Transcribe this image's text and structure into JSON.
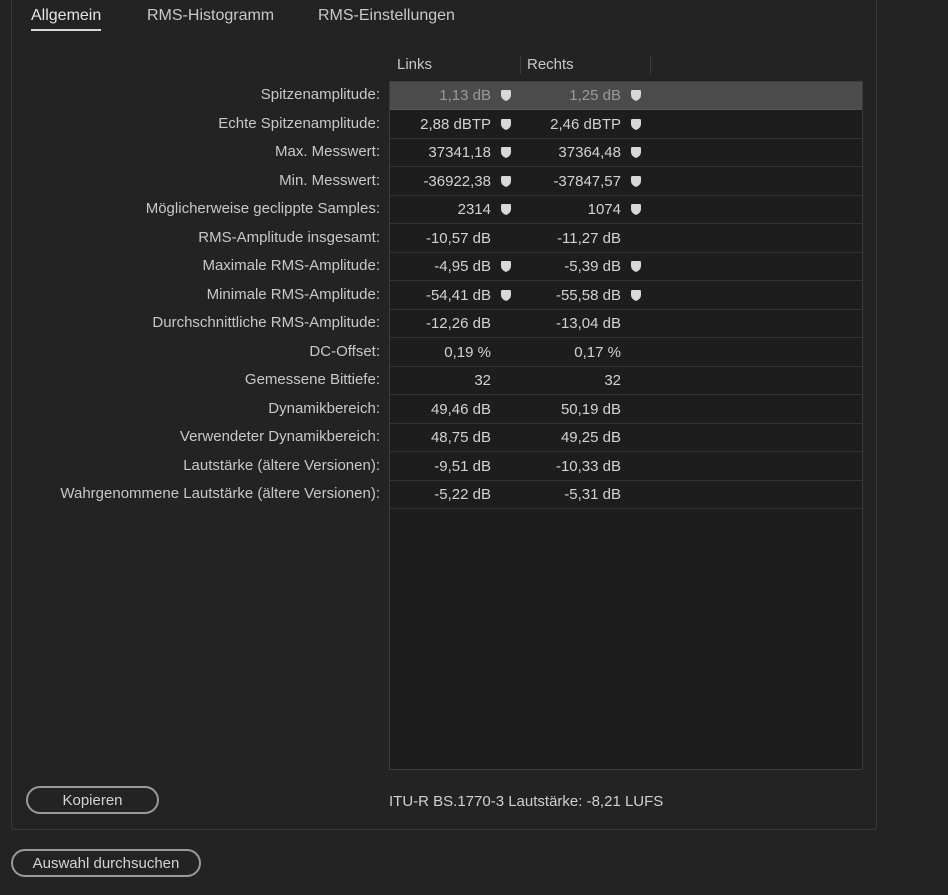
{
  "tabs": [
    {
      "label": "Allgemein",
      "active": true
    },
    {
      "label": "RMS-Histogramm",
      "active": false
    },
    {
      "label": "RMS-Einstellungen",
      "active": false
    }
  ],
  "columns": {
    "left": "Links",
    "right": "Rechts"
  },
  "rows": [
    {
      "label": "Spitzenamplitude:",
      "left": "1,13 dB",
      "right": "1,25 dB",
      "marker": true,
      "selected": true
    },
    {
      "label": "Echte Spitzenamplitude:",
      "left": "2,88 dBTP",
      "right": "2,46 dBTP",
      "marker": true
    },
    {
      "label": "Max. Messwert:",
      "left": "37341,18",
      "right": "37364,48",
      "marker": true
    },
    {
      "label": "Min. Messwert:",
      "left": "-36922,38",
      "right": "-37847,57",
      "marker": true
    },
    {
      "label": "Möglicherweise geclippte Samples:",
      "left": "2314",
      "right": "1074",
      "marker": true
    },
    {
      "label": "RMS-Amplitude insgesamt:",
      "left": "-10,57 dB",
      "right": "-11,27 dB",
      "marker": false
    },
    {
      "label": "Maximale RMS-Amplitude:",
      "left": "-4,95 dB",
      "right": "-5,39 dB",
      "marker": true
    },
    {
      "label": "Minimale RMS-Amplitude:",
      "left": "-54,41 dB",
      "right": "-55,58 dB",
      "marker": true
    },
    {
      "label": "Durchschnittliche RMS-Amplitude:",
      "left": "-12,26 dB",
      "right": "-13,04 dB",
      "marker": false
    },
    {
      "label": "DC-Offset:",
      "left": "0,19 %",
      "right": "0,17 %",
      "marker": false
    },
    {
      "label": "Gemessene Bittiefe:",
      "left": "32",
      "right": "32",
      "marker": false
    },
    {
      "label": "Dynamikbereich:",
      "left": "49,46 dB",
      "right": "50,19 dB",
      "marker": false
    },
    {
      "label": "Verwendeter Dynamikbereich:",
      "left": "48,75 dB",
      "right": "49,25 dB",
      "marker": false
    },
    {
      "label": "Lautstärke (ältere Versionen):",
      "left": "-9,51 dB",
      "right": "-10,33 dB",
      "marker": false
    },
    {
      "label": "Wahrgenommene Lautstärke (ältere Versionen):",
      "left": "-5,22 dB",
      "right": "-5,31 dB",
      "marker": false
    }
  ],
  "buttons": {
    "copy": "Kopieren",
    "scan": "Auswahl durchsuchen"
  },
  "footer": {
    "itu_label": "ITU-R BS.1770-3 Lautstärke:",
    "itu_value": "-8,21 LUFS"
  },
  "colors": {
    "background": "#232323",
    "table_bg": "#1d1d1d",
    "selected_row": "#4b4b4b",
    "marker": "#d8d8d8"
  },
  "icons": {
    "marker": "location-marker-icon"
  }
}
